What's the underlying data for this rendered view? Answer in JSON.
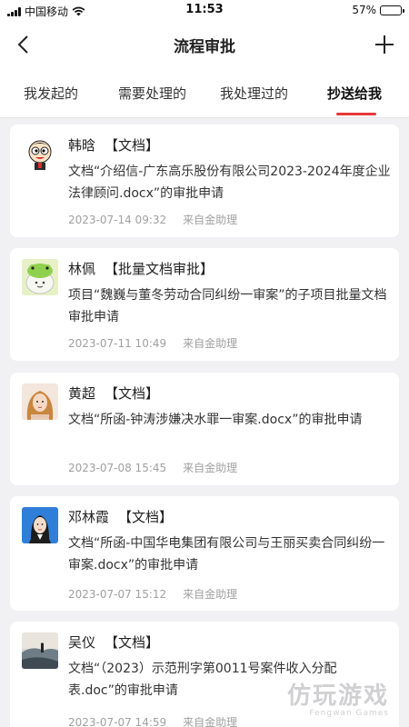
{
  "status_bar": {
    "carrier": "中国移动",
    "time": "11:53",
    "battery_text": "57%",
    "battery_level": 0.57
  },
  "nav": {
    "title": "流程审批"
  },
  "tabs": [
    {
      "label": "我发起的",
      "active": false
    },
    {
      "label": "需要处理的",
      "active": false
    },
    {
      "label": "我处理过的",
      "active": false
    },
    {
      "label": "抄送给我",
      "active": true
    }
  ],
  "items": [
    {
      "name": "韩晗",
      "tag": "【文档】",
      "desc": "文档“介绍信-广东高乐股份有限公司2023-2024年度企业法律顾问.docx”的审批申请",
      "time": "2023-07-14 09:32",
      "source": "来自金助理",
      "avatar": "cartoon-avatar"
    },
    {
      "name": "林佩",
      "tag": "【批量文档审批】",
      "desc": "项目“魏巍与董冬劳动合同纠纷一审案”的子项目批量文档审批申请",
      "time": "2023-07-11 10:49",
      "source": "来自金助理",
      "avatar": "frog-avatar"
    },
    {
      "name": "黄超",
      "tag": "【文档】",
      "desc": "文档“所函-钟涛涉嫌决水罪一审案.docx”的审批申请",
      "time": "2023-07-08 15:45",
      "source": "来自金助理",
      "avatar": "photo-avatar"
    },
    {
      "name": "邓林霞",
      "tag": "【文档】",
      "desc": "文档“所函-中国华电集团有限公司与王丽买卖合同纠纷一审案.docx”的审批申请",
      "time": "2023-07-07 15:12",
      "source": "来自金助理",
      "avatar": "portrait-avatar"
    },
    {
      "name": "吴仪",
      "tag": "【文档】",
      "desc": "文档“（2023）示范刑字第0011号案件收入分配表.doc”的审批申请",
      "time": "2023-07-07 14:59",
      "source": "来自金助理",
      "avatar": "landscape-avatar"
    }
  ],
  "watermark": {
    "text": "仿玩游戏",
    "sub": "Fengwan Games"
  }
}
